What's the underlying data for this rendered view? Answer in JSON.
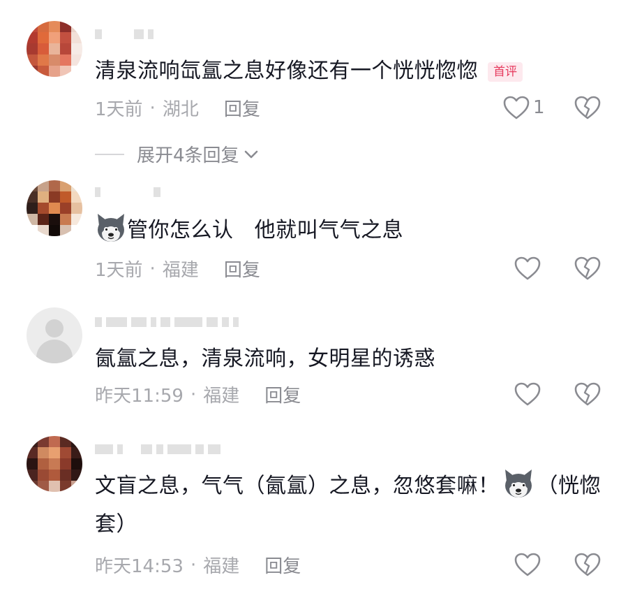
{
  "comments": [
    {
      "text": "清泉流响氙氲之息好像还有一个恍恍惚惚",
      "badge": "首评",
      "time": "1天前",
      "location": "湖北",
      "reply_label": "回复",
      "likes": "1"
    },
    {
      "text": "管你怎么认   他就叫气气之息",
      "time": "1天前",
      "location": "福建",
      "reply_label": "回复",
      "likes": ""
    },
    {
      "text": "氤氲之息，清泉流响，女明星的诱惑",
      "time": "昨天11:59",
      "location": "福建",
      "reply_label": "回复",
      "likes": ""
    },
    {
      "text_a": "文盲之息，气气（氤氲）之息，忽悠套嘛！",
      "text_b": "（恍惚套）",
      "time": "昨天14:53",
      "location": "福建",
      "reply_label": "回复",
      "likes": ""
    }
  ],
  "expand_replies_label": "展开4条回复",
  "meta_separator": "·",
  "icons": {
    "like": "heart-outline-icon",
    "dislike": "broken-heart-icon",
    "emoji": "husky-dog-emoji-icon",
    "expand": "chevron-down-icon"
  },
  "colors": {
    "text": "#161823",
    "meta": "#a7a8ad",
    "badge_bg": "#fde9ee",
    "badge_text": "#e6395d"
  }
}
